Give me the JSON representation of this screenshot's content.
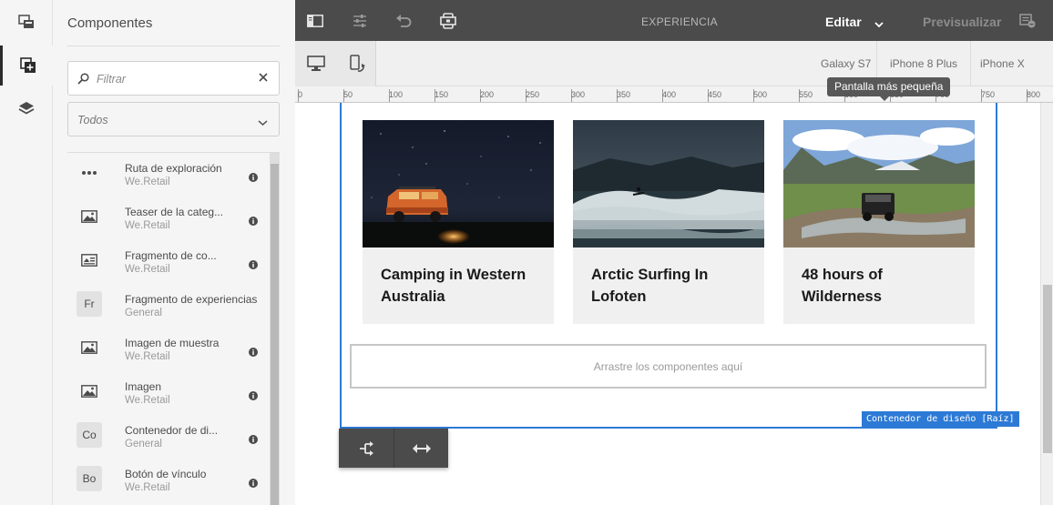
{
  "rail": {
    "items": [
      {
        "name": "pages-icon"
      },
      {
        "name": "components-icon"
      },
      {
        "name": "layers-icon"
      }
    ]
  },
  "panel": {
    "title": "Componentes",
    "search_placeholder": "Filtrar",
    "filter_selected": "Todos",
    "components": [
      {
        "name": "Ruta de exploración",
        "group": "We.Retail",
        "icon": "more-icon"
      },
      {
        "name": "Teaser de la categ...",
        "group": "We.Retail",
        "icon": "image-icon"
      },
      {
        "name": "Fragmento de co...",
        "group": "We.Retail",
        "icon": "content-fragment-icon"
      },
      {
        "name": "Fragmento de experiencias",
        "group": "General",
        "abbr": "Fr"
      },
      {
        "name": "Imagen de muestra",
        "group": "We.Retail",
        "icon": "image-icon"
      },
      {
        "name": "Imagen",
        "group": "We.Retail",
        "icon": "image-icon"
      },
      {
        "name": "Contenedor de di...",
        "group": "General",
        "abbr": "Co"
      },
      {
        "name": "Botón de vínculo",
        "group": "We.Retail",
        "abbr": "Bo"
      }
    ]
  },
  "topbar": {
    "title": "EXPERIENCIA",
    "mode": "Editar",
    "preview": "Previsualizar"
  },
  "devices": [
    "Galaxy S7",
    "iPhone 8 Plus",
    "iPhone X"
  ],
  "ruler_ticks": [
    "0",
    "50",
    "100",
    "150",
    "200",
    "250",
    "300",
    "350",
    "400",
    "450",
    "500",
    "550",
    "600",
    "650",
    "700",
    "750",
    "800"
  ],
  "tooltip": "Pantalla más pequeña",
  "cards": [
    {
      "title": "Camping in Western Australia"
    },
    {
      "title": "Arctic Surfing In Lofoten"
    },
    {
      "title": "48 hours of Wilderness"
    }
  ],
  "dropzone": "Arrastre los componentes aquí",
  "container_label": "Contenedor de diseño [Raíz]"
}
